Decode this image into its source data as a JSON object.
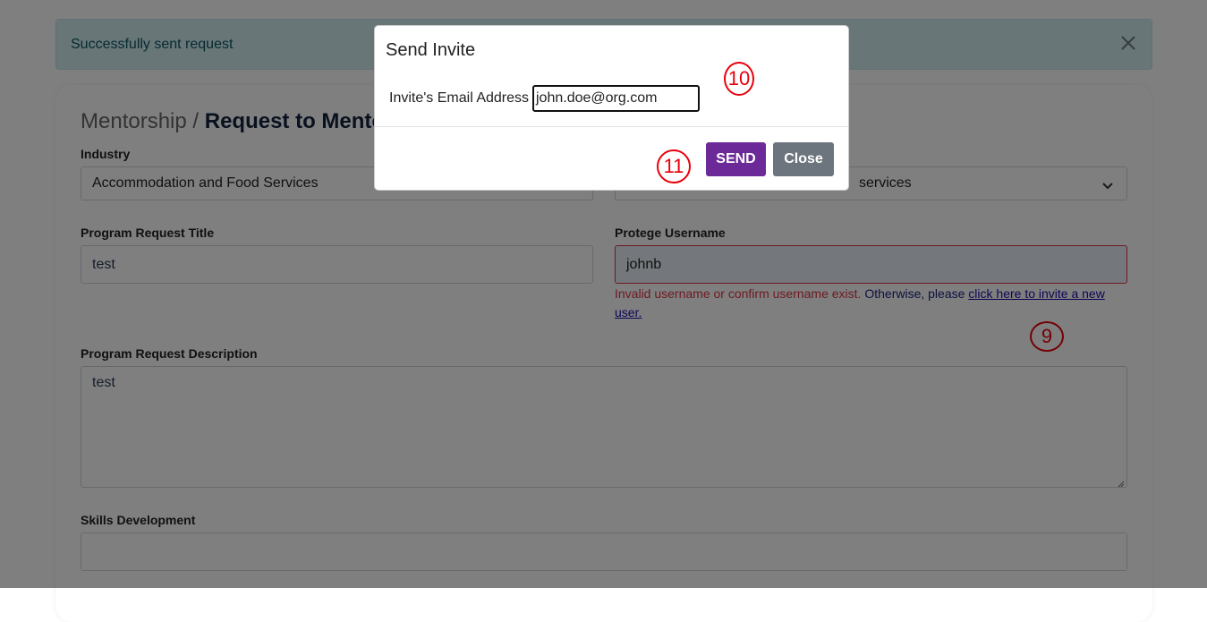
{
  "alert": {
    "message": "Successfully sent request",
    "close_icon": "close-icon"
  },
  "breadcrumb": {
    "parent": "Mentorship /",
    "current": "Request to Mentor"
  },
  "form": {
    "industry": {
      "label": "Industry",
      "value": "Accommodation and Food Services"
    },
    "service": {
      "value": "services"
    },
    "title": {
      "label": "Program Request Title",
      "value": "test"
    },
    "protege": {
      "label": "Protege Username",
      "value": "johnb",
      "error": "Invalid username or confirm username exist.",
      "otherwise": "Otherwise, please",
      "link": "click here to invite a new user."
    },
    "description": {
      "label": "Program Request Description",
      "value": "test"
    },
    "skills": {
      "label": "Skills Development",
      "value": ""
    }
  },
  "modal": {
    "title": "Send Invite",
    "email_label": "Invite's Email Address",
    "email_value": "john.doe@org.com",
    "send_label": "SEND",
    "close_label": "Close",
    "send_color": "#6c2a99",
    "close_color": "#6c757d"
  },
  "annotations": {
    "a9": "9",
    "a10": "10",
    "a11": "11"
  }
}
